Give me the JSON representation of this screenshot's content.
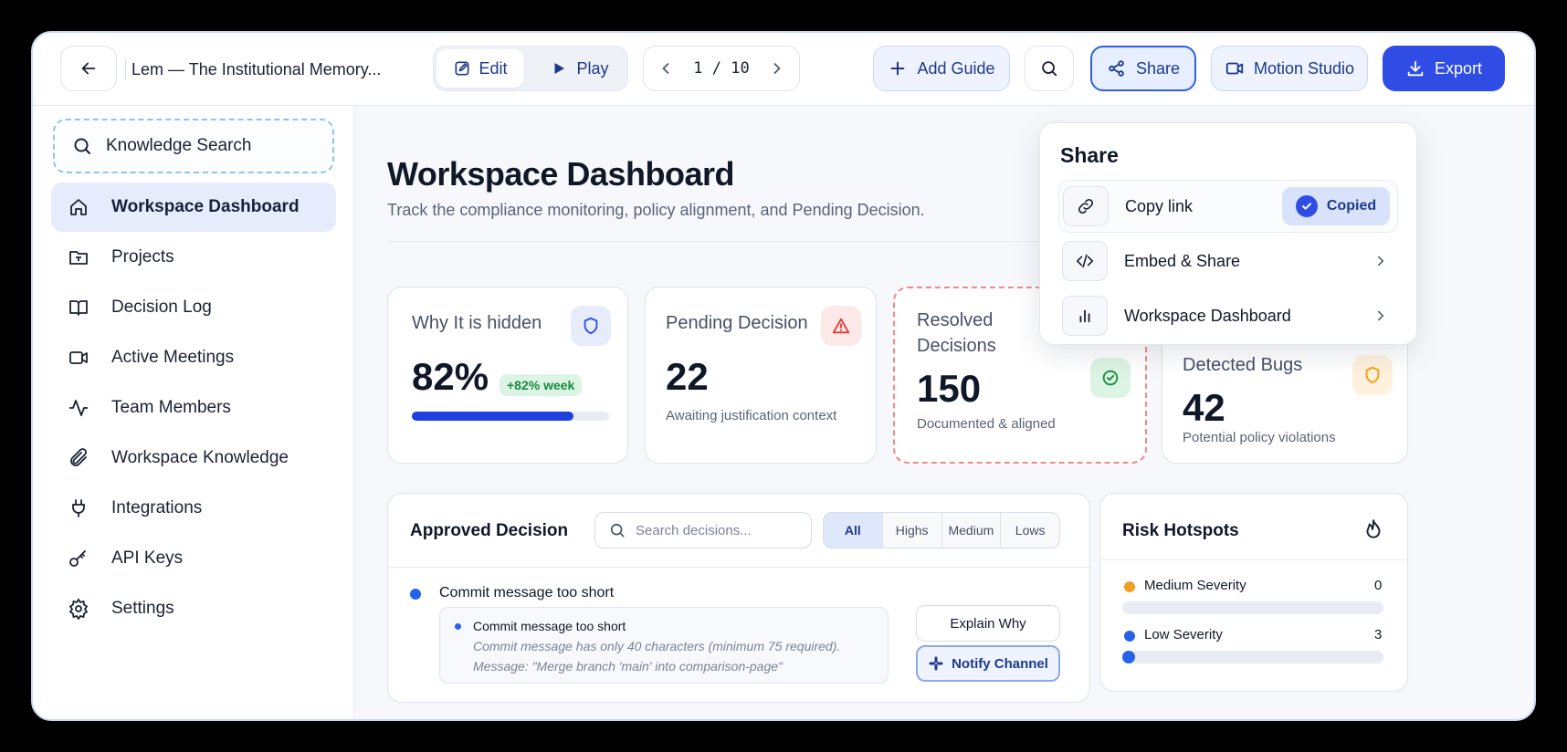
{
  "colors": {
    "accent": "#2f4de5",
    "accent_light": "#e6eeff",
    "sidebar_active_bg": "#e6ecfb",
    "danger_light": "#fde8e8",
    "danger": "#e53935",
    "success_light": "#dcf4e3",
    "success": "#188a42",
    "warning_light": "#fef1dd",
    "warning": "#f59e0b",
    "dashed_danger": "#f08a8a",
    "dot_orange": "#f0a020",
    "dot_blue": "#2563eb"
  },
  "topbar": {
    "back_icon": "arrow-left-icon",
    "doc_title": "Lem — The Institutional Memory...",
    "mode": {
      "edit_label": "Edit",
      "play_label": "Play",
      "active": "Edit"
    },
    "pager": {
      "text": "1 / 10",
      "current": 1,
      "total": 10
    },
    "add_guide_label": "Add Guide",
    "search_icon": "search-icon",
    "share_label": "Share",
    "motion_studio_label": "Motion Studio",
    "export_label": "Export"
  },
  "sidebar": {
    "search_label": "Knowledge Search",
    "items": [
      {
        "label": "Workspace Dashboard",
        "icon": "home-icon",
        "active": true
      },
      {
        "label": "Projects",
        "icon": "folder-icon",
        "active": false
      },
      {
        "label": "Decision Log",
        "icon": "book-icon",
        "active": false
      },
      {
        "label": "Active Meetings",
        "icon": "video-icon",
        "active": false
      },
      {
        "label": "Team Members",
        "icon": "activity-icon",
        "active": false
      },
      {
        "label": "Workspace Knowledge",
        "icon": "paperclip-icon",
        "active": false
      },
      {
        "label": "Integrations",
        "icon": "plug-icon",
        "active": false
      },
      {
        "label": "API Keys",
        "icon": "key-icon",
        "active": false
      },
      {
        "label": "Settings",
        "icon": "gear-icon",
        "active": false
      }
    ]
  },
  "main": {
    "title": "Workspace Dashboard",
    "subtitle": "Track the compliance monitoring, policy alignment, and Pending Decision.",
    "cards": [
      {
        "title": "Why It is hidden",
        "value": "82%",
        "chip": "+82% week",
        "progress": 0.82,
        "icon": "shield-icon"
      },
      {
        "title": "Pending Decision",
        "value": "22",
        "sub": "Awaiting justification context",
        "icon": "alert-triangle-icon"
      },
      {
        "title_line1": "Resolved",
        "title_line2": "Decisions",
        "value": "150",
        "sub": "Documented & aligned",
        "icon": "check-circle-icon"
      },
      {
        "title": "Detected Bugs",
        "value": "42",
        "sub": "Potential policy violations",
        "icon": "shield-warning-icon"
      }
    ],
    "approved": {
      "title": "Approved Decision",
      "search_placeholder": "Search decisions...",
      "filters": [
        "All",
        "Highs",
        "Medium",
        "Lows"
      ],
      "active_filter": "All",
      "item": {
        "heading": "Commit message too short",
        "detail_title": "Commit message too short",
        "detail_line1": "Commit message has only 40 characters (minimum 75 required).",
        "detail_line2": "Message: \"Merge branch 'main' into comparison-page\"",
        "explain_label": "Explain Why",
        "notify_label": "Notify Channel"
      }
    },
    "risk": {
      "title": "Risk Hotspots",
      "icon": "flame-icon",
      "rows": [
        {
          "label": "Medium Severity",
          "count": "0",
          "fill": 0
        },
        {
          "label": "Low Severity",
          "count": "3",
          "fill": 0.02
        }
      ]
    }
  },
  "share_popover": {
    "title": "Share",
    "rows": [
      {
        "label": "Copy link",
        "icon": "link-icon",
        "status": "Copied"
      },
      {
        "label": "Embed & Share",
        "icon": "code-icon"
      },
      {
        "label": "Workspace Dashboard",
        "icon": "bar-chart-icon"
      }
    ]
  }
}
